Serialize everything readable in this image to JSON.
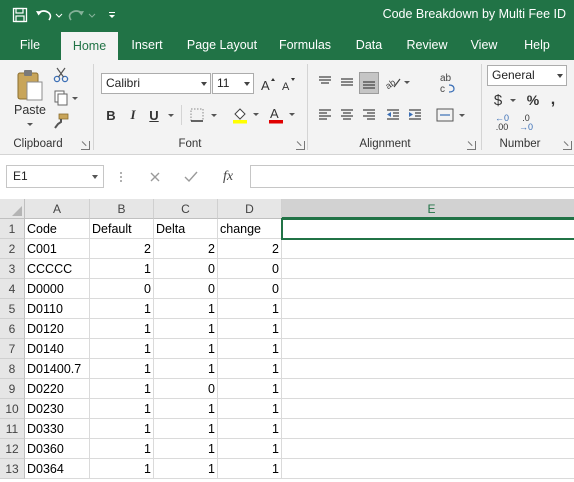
{
  "app": {
    "title": "Code Breakdown by Multi Fee ID",
    "accent_color": "#217346",
    "quick_access": [
      {
        "icon": "save-icon"
      },
      {
        "icon": "undo-icon"
      },
      {
        "icon": "redo-icon"
      },
      {
        "icon": "customize-qat-icon"
      }
    ]
  },
  "tabs": [
    "File",
    "Home",
    "Insert",
    "Page Layout",
    "Formulas",
    "Data",
    "Review",
    "View",
    "Help"
  ],
  "active_tab": "Home",
  "ribbon": {
    "clipboard": {
      "label": "Clipboard",
      "paste_label": "Paste"
    },
    "font": {
      "label": "Font",
      "name": "Calibri",
      "size": "11",
      "bold": "B",
      "italic": "I",
      "underline": "U"
    },
    "alignment": {
      "label": "Alignment"
    },
    "number": {
      "label": "Number",
      "format": "General",
      "currency": "$",
      "percent": "%",
      "comma": ",",
      "inc_decimal": ".00",
      "dec_decimal": ".0"
    }
  },
  "formula_bar": {
    "name_box": "E1",
    "fx": "fx",
    "value": ""
  },
  "sheet": {
    "columns": [
      "A",
      "B",
      "C",
      "D",
      "E"
    ],
    "selected_column": "E",
    "row_numbers": [
      "1",
      "2",
      "3",
      "4",
      "5",
      "6",
      "7",
      "8",
      "9",
      "10",
      "11",
      "12",
      "13"
    ],
    "header_row": [
      "Code",
      "Default",
      "Delta",
      "change"
    ],
    "rows": [
      [
        "C001",
        "2",
        "2",
        "2"
      ],
      [
        "CCCCC",
        "1",
        "0",
        "0"
      ],
      [
        "D0000",
        "0",
        "0",
        "0"
      ],
      [
        "D0110",
        "1",
        "1",
        "1"
      ],
      [
        "D0120",
        "1",
        "1",
        "1"
      ],
      [
        "D0140",
        "1",
        "1",
        "1"
      ],
      [
        "D01400.7",
        "1",
        "1",
        "1"
      ],
      [
        "D0220",
        "1",
        "0",
        "1"
      ],
      [
        "D0230",
        "1",
        "1",
        "1"
      ],
      [
        "D0330",
        "1",
        "1",
        "1"
      ],
      [
        "D0360",
        "1",
        "1",
        "1"
      ],
      [
        "D0364",
        "1",
        "1",
        "1"
      ]
    ]
  }
}
